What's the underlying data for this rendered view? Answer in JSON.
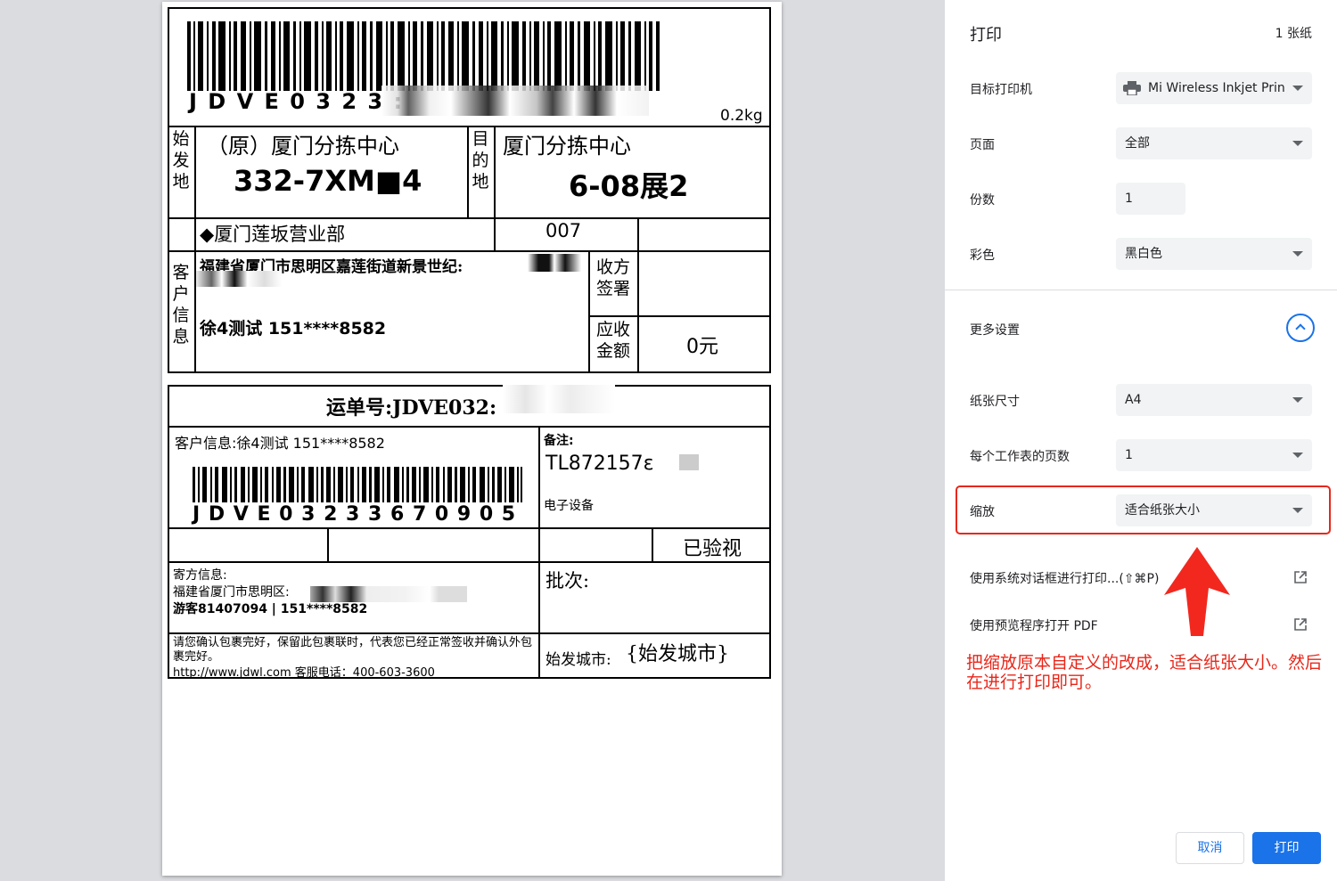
{
  "label": {
    "barcode_top_text": "J D V E 0 3 2 3 :",
    "weight": "0.2kg",
    "origin_header": "始发地",
    "origin_center": "（原）厦门分拣中心",
    "origin_code": "332-7XM■4",
    "dest_header": "目的地",
    "dest_center": "厦门分拣中心",
    "dest_code": "6-08展2",
    "branch": "◆厦门莲坂营业部",
    "branch_code": "007",
    "customer_header": "客户信息",
    "address": "福建省厦门市思明区嘉莲街道新景世纪:",
    "customer": "徐4测试 151****8582",
    "sign_label": "收方签署",
    "amount_label": "应收金额",
    "amount_value": "0元",
    "waybill": "运单号:JDVE032:",
    "customer_info": "客户信息:徐4测试 151****8582",
    "barcode_bottom_text": "J D V E 0 3 2 3 3 6 7 0 9 0 5",
    "remark_label": "备注:",
    "remark_value": "TL872157ε",
    "remark_item": "电子设备",
    "inspected": "已验视",
    "sender_label": "寄方信息:",
    "sender_address": "福建省厦门市思明区:",
    "sender_contact": "游客81407094 | 151****8582",
    "batch_label": "批次:",
    "disclaimer": "请您确认包裹完好，保留此包裹联时，代表您已经正常签收并确认外包裹完好。",
    "footer_url": "http://www.jdwl.com    客服电话：400-603-3600",
    "origin_city_label": "始发城市:",
    "origin_city_value": "{始发城市}"
  },
  "panel": {
    "title": "打印",
    "sheets": "1 张纸",
    "printer_label": "目标打印机",
    "printer_value": "Mi Wireless Inkjet Prin",
    "printer_icon": "printer-icon",
    "pages_label": "页面",
    "pages_value": "全部",
    "copies_label": "份数",
    "copies_value": "1",
    "color_label": "彩色",
    "color_value": "黑白色",
    "more_label": "更多设置",
    "paper_label": "纸张尺寸",
    "paper_value": "A4",
    "per_sheet_label": "每个工作表的页数",
    "per_sheet_value": "1",
    "scale_label": "缩放",
    "scale_value": "适合纸张大小",
    "system_dialog": "使用系统对话框进行打印...(⇧⌘P)",
    "open_pdf": "使用预览程序打开 PDF",
    "note": "把缩放原本自定义的改成，适合纸张大小。然后在进行打印即可。",
    "cancel": "取消",
    "print": "打印",
    "accent_color": "#1a73e8",
    "annotation_color": "#e8271a"
  }
}
